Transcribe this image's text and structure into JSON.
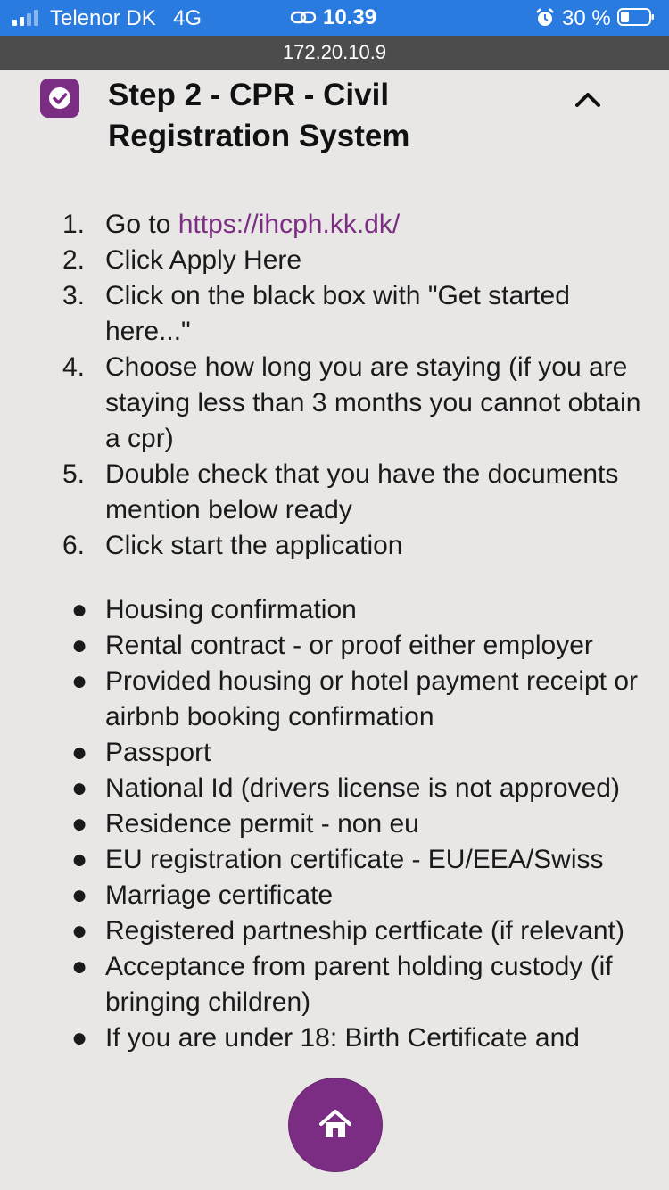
{
  "status_bar": {
    "carrier": "Telenor DK",
    "network": "4G",
    "time": "10.39",
    "battery_percent": "30 %",
    "signal_icon": "signal-bars-icon",
    "link_icon": "personal-hotspot-icon",
    "alarm_icon": "alarm-clock-icon",
    "battery_icon": "battery-icon",
    "battery_level": 0.3
  },
  "browser": {
    "url": "172.20.10.9"
  },
  "step": {
    "title": "Step 2 - CPR - Civil Registration System",
    "completed": true,
    "check_icon": "checkmark-icon",
    "toggle_icon": "chevron-up-icon"
  },
  "instructions": [
    {
      "number": "1.",
      "prefix": "Go to ",
      "link": "https://ihcph.kk.dk/"
    },
    {
      "number": "2.",
      "text": "Click Apply Here"
    },
    {
      "number": "3.",
      "text": "Click on the black box with \"Get started here...\""
    },
    {
      "number": "4.",
      "text": "Choose how long you are staying (if you are staying less than 3 months you cannot obtain a cpr)"
    },
    {
      "number": "5.",
      "text": "Double check that you have the documents mention below ready"
    },
    {
      "number": "6.",
      "text": "Click start the application"
    }
  ],
  "documents": [
    "Housing confirmation",
    "Rental contract - or proof either employer",
    "Provided housing or hotel payment receipt or airbnb booking confirmation",
    "Passport",
    "National Id (drivers license is not approved)",
    "Residence permit - non eu",
    "EU registration certificate - EU/EEA/Swiss",
    "Marriage certificate",
    "Registered partneship certficate (if relevant)",
    "Acceptance from parent holding custody (if bringing children)",
    "If you are under 18: Birth Certificate and"
  ],
  "colors": {
    "accent": "#7b2d83",
    "status_bar": "#2a7be0",
    "url_bar": "#4c4c4c",
    "background": "#e8e7e5"
  },
  "home_button": {
    "icon": "home-icon"
  }
}
